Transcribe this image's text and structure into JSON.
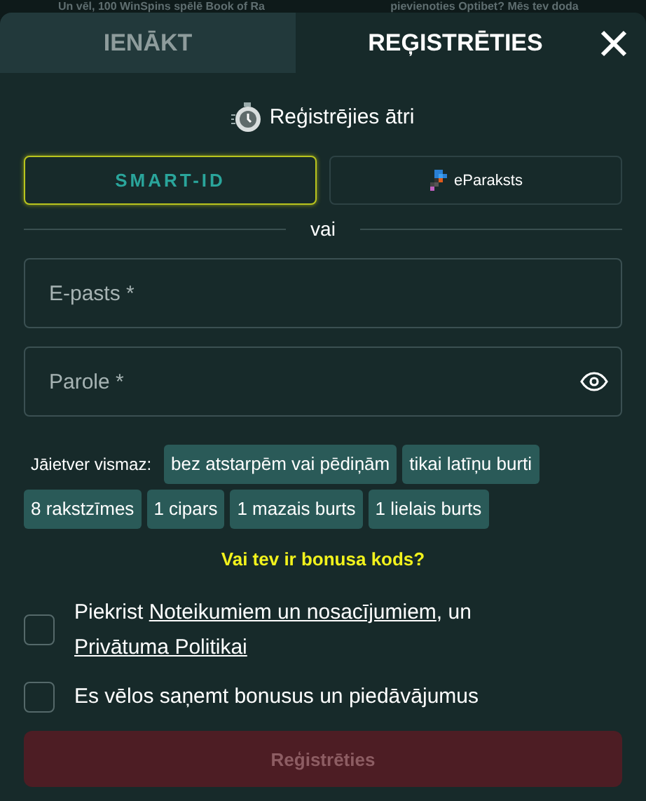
{
  "background_banners": [
    "Un vēl, 100 WinSpins spēlē Book of Ra",
    "pievienoties Optibet? Mēs tev doda"
  ],
  "tabs": [
    {
      "label": "IENĀKT",
      "selected": false
    },
    {
      "label": "REĢISTRĒTIES",
      "selected": true
    }
  ],
  "quick_title": "Reģistrējies ātri",
  "quick_options": [
    {
      "kind": "smart-id",
      "label": "SMART-ID",
      "selected": true
    },
    {
      "kind": "eparaksts",
      "label": "eParaksts",
      "selected": false
    }
  ],
  "divider": "vai",
  "fields": [
    {
      "kind": "text",
      "placeholder": "E-pasts *"
    },
    {
      "kind": "password",
      "placeholder": "Parole *"
    }
  ],
  "requirements": {
    "label": "Jāietver vismaz:",
    "items": [
      "bez atstarpēm vai pēdiņām",
      "tikai latīņu burti",
      "8 rakstzīmes",
      "1 cipars",
      "1 mazais burts",
      "1 lielais burts"
    ]
  },
  "bonus_link": "Vai tev ir bonusa kods?",
  "consents": [
    {
      "checked": false,
      "parts": [
        {
          "text": "Piekrist ",
          "link": false
        },
        {
          "text": "Noteikumiem un nosacījumiem",
          "link": true
        },
        {
          "text": ", un ",
          "link": false
        },
        {
          "text": "Privātuma Politikai",
          "link": true
        }
      ]
    },
    {
      "checked": false,
      "parts": [
        {
          "text": "Es vēlos saņemt bonusus un piedāvājumus",
          "link": false
        }
      ]
    }
  ],
  "submit": {
    "label": "Reģistrēties",
    "disabled": true
  }
}
